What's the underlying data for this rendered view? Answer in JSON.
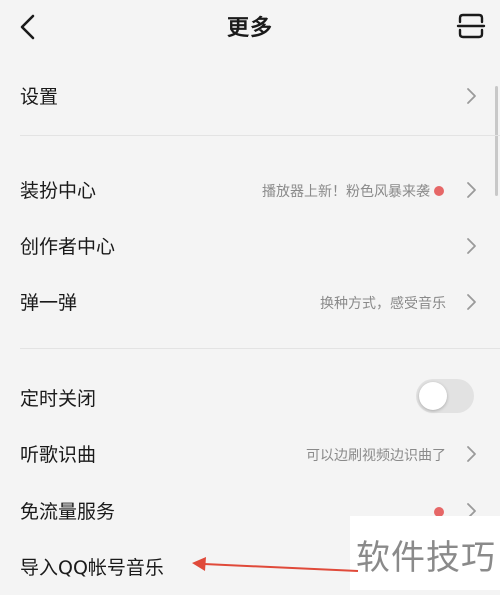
{
  "header": {
    "title": "更多"
  },
  "sections": [
    {
      "items": [
        {
          "label": "设置"
        }
      ]
    },
    {
      "items": [
        {
          "label": "装扮中心",
          "hint": "播放器上新！粉色风暴来袭",
          "dot": true
        },
        {
          "label": "创作者中心"
        },
        {
          "label": "弹一弹",
          "hint": "换种方式，感受音乐"
        }
      ]
    },
    {
      "items": [
        {
          "label": "定时关闭",
          "toggle": "off"
        },
        {
          "label": "听歌识曲",
          "hint": "可以边刷视频边识曲了"
        },
        {
          "label": "免流量服务",
          "dot": true
        },
        {
          "label": "导入QQ帐号音乐"
        }
      ]
    }
  ],
  "watermark": "软件技巧",
  "colors": {
    "dot": "#e66767",
    "arrow": "#e04a3a",
    "background": "#f4f4f4"
  }
}
